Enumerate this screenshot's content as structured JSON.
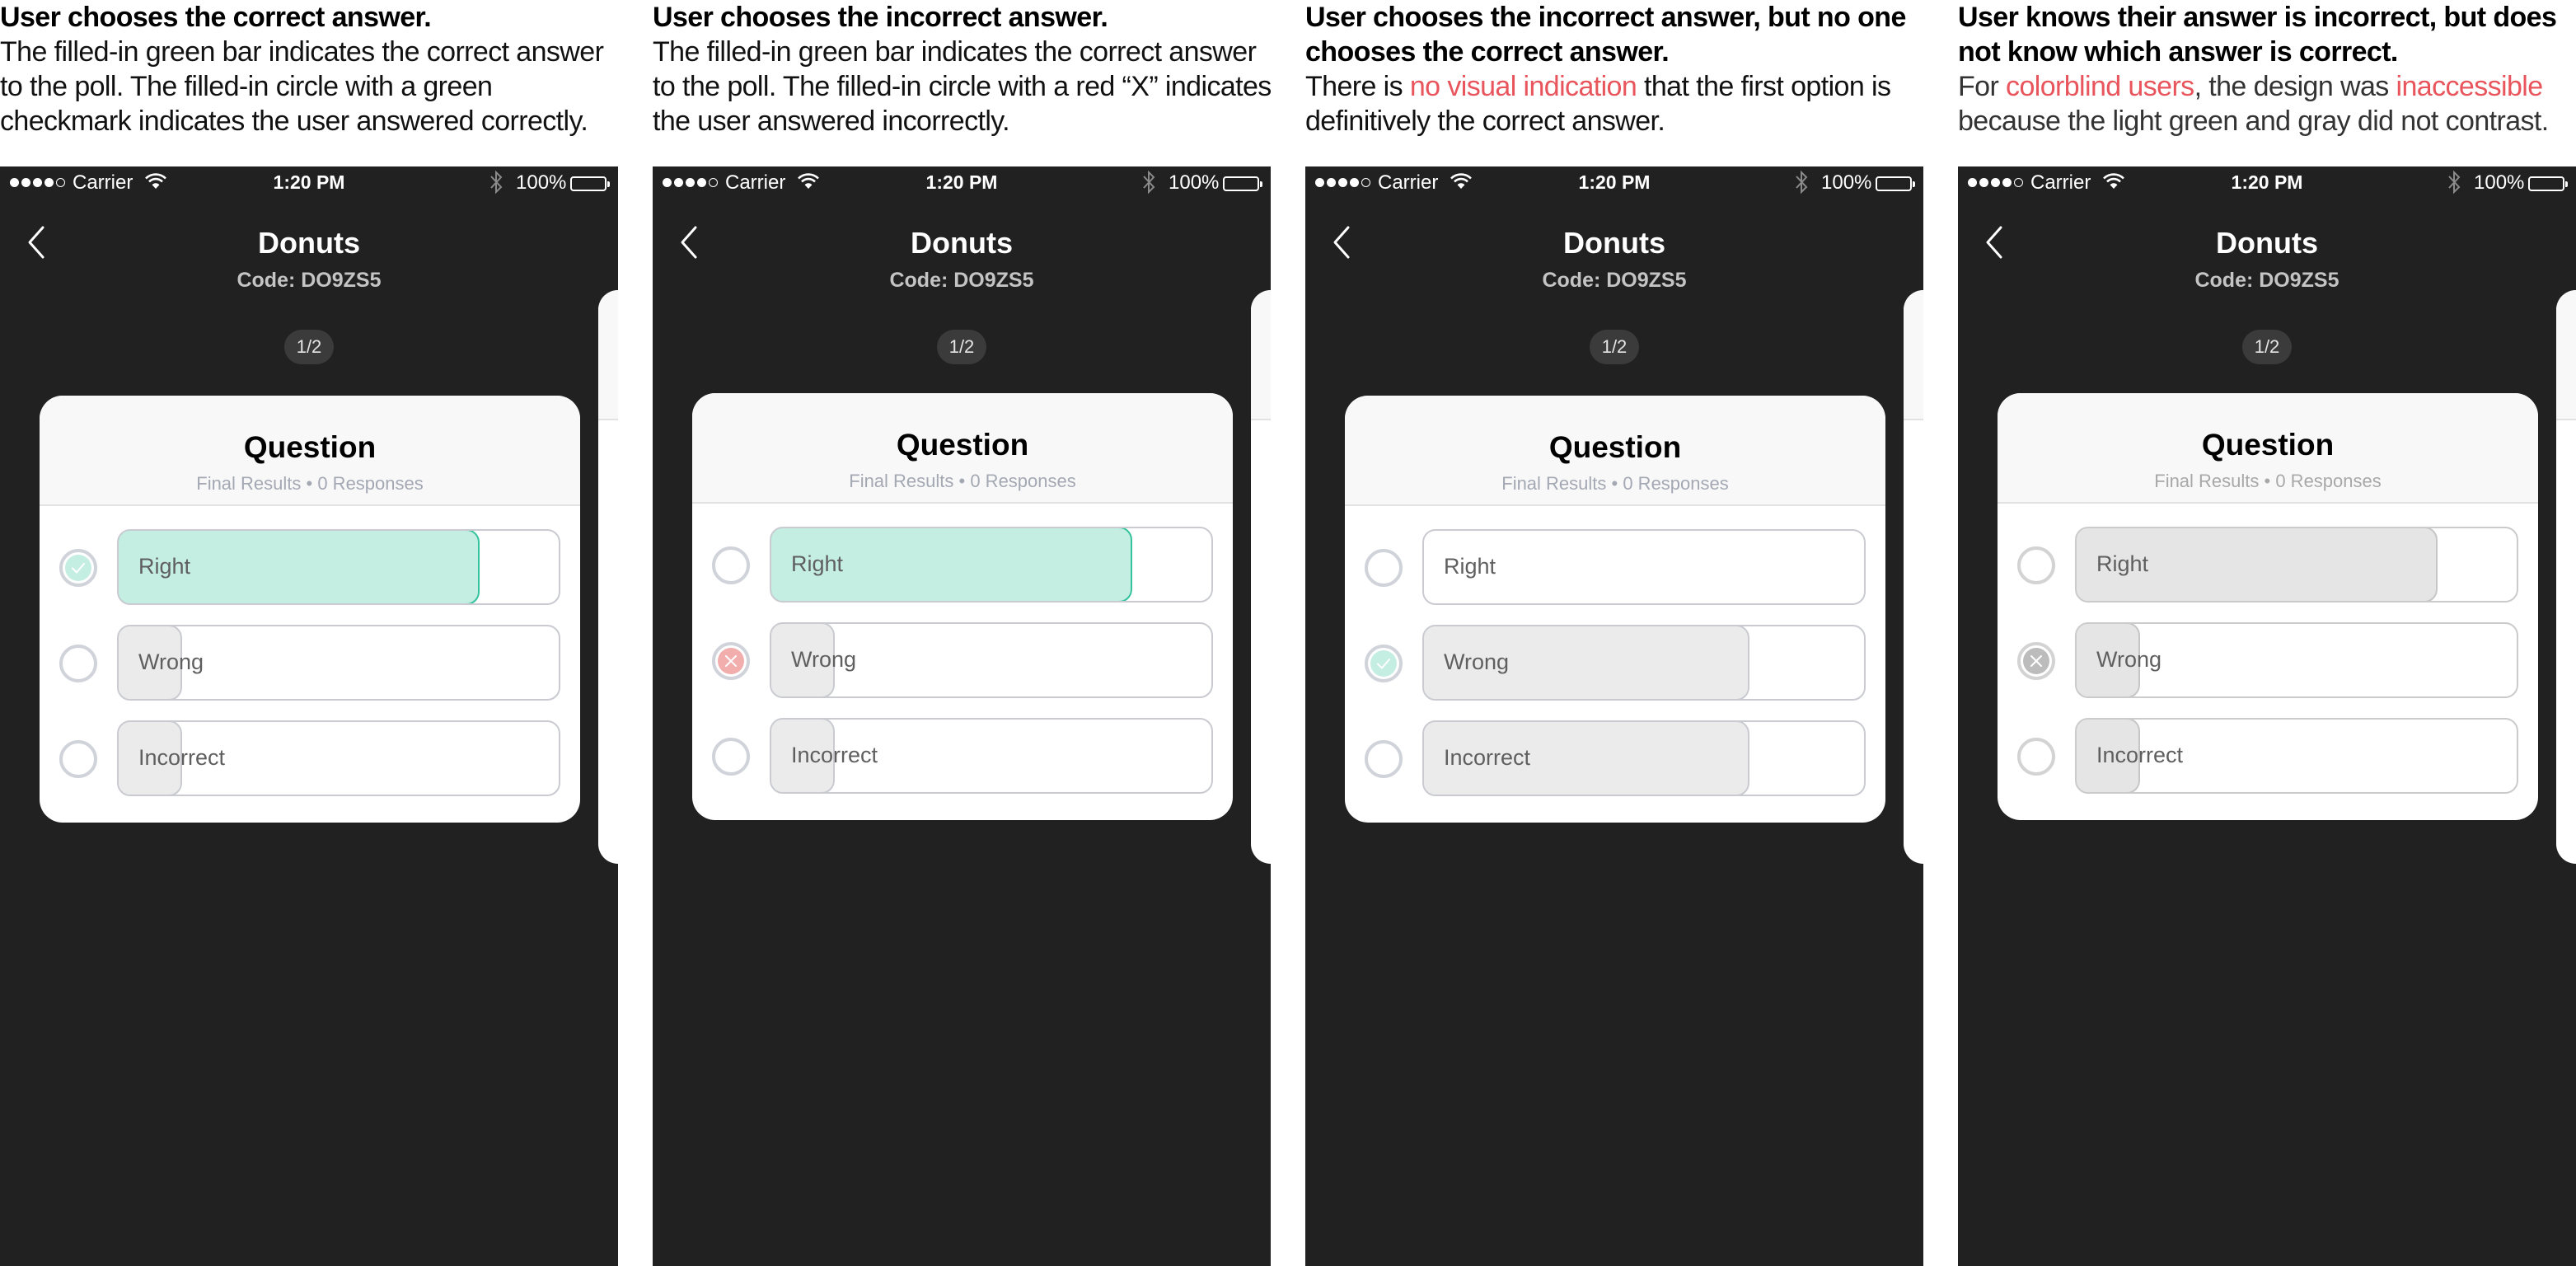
{
  "panels": [
    {
      "caption": {
        "title": "User chooses the correct answer.",
        "body": [
          {
            "text": "The filled-in green bar indicates the correct answer to the poll. The filled-in circle with a green checkmark indicates the user answered correctly.",
            "highlight": false
          }
        ]
      },
      "phone": {
        "status": {
          "carrier": "Carrier",
          "time": "1:20 PM",
          "battery": "100%"
        },
        "nav": {
          "title": "Donuts",
          "code": "Code: DO9ZS5"
        },
        "pager": "1/2",
        "card": {
          "title": "Question",
          "subtitle": "Final Results • 0 Responses",
          "options": [
            {
              "label": "Right",
              "fill": 0.81,
              "fill_style": "green",
              "selected": "check"
            },
            {
              "label": "Wrong",
              "fill": 0.14,
              "fill_style": "gray",
              "selected": "none"
            },
            {
              "label": "Incorrect",
              "fill": 0.14,
              "fill_style": "gray",
              "selected": "none"
            }
          ]
        }
      }
    },
    {
      "caption": {
        "title": "User chooses the incorrect answer.",
        "body": [
          {
            "text": "The filled-in green bar indicates the correct answer to the poll. The filled-in circle with a red “X” indicates the user answered incorrectly.",
            "highlight": false
          }
        ]
      },
      "phone": {
        "status": {
          "carrier": "Carrier",
          "time": "1:20 PM",
          "battery": "100%"
        },
        "nav": {
          "title": "Donuts",
          "code": "Code: DO9ZS5"
        },
        "pager": "1/2",
        "card": {
          "title": "Question",
          "subtitle": "Final Results • 0 Responses",
          "options": [
            {
              "label": "Right",
              "fill": 0.81,
              "fill_style": "green",
              "selected": "none"
            },
            {
              "label": "Wrong",
              "fill": 0.14,
              "fill_style": "gray",
              "selected": "x"
            },
            {
              "label": "Incorrect",
              "fill": 0.14,
              "fill_style": "gray",
              "selected": "none"
            }
          ]
        }
      }
    },
    {
      "caption": {
        "title": "User chooses the incorrect answer, but no one chooses the correct answer.",
        "body": [
          {
            "text": "There is ",
            "highlight": false
          },
          {
            "text": "no visual indication",
            "highlight": true
          },
          {
            "text": " that the first option is definitively the correct answer.",
            "highlight": false
          }
        ]
      },
      "phone": {
        "status": {
          "carrier": "Carrier",
          "time": "1:20 PM",
          "battery": "100%"
        },
        "nav": {
          "title": "Donuts",
          "code": "Code: DO9ZS5"
        },
        "pager": "1/2",
        "card": {
          "title": "Question",
          "subtitle": "Final Results • 0 Responses",
          "options": [
            {
              "label": "Right",
              "fill": 0,
              "fill_style": "gray",
              "selected": "none"
            },
            {
              "label": "Wrong",
              "fill": 0.73,
              "fill_style": "gray",
              "selected": "check"
            },
            {
              "label": "Incorrect",
              "fill": 0.73,
              "fill_style": "gray",
              "selected": "none"
            }
          ]
        }
      }
    },
    {
      "caption": {
        "title": "User knows their answer is incorrect, but does not know which answer is correct.",
        "body": [
          {
            "text": "For ",
            "highlight": false
          },
          {
            "text": "colorblind users",
            "highlight": true
          },
          {
            "text": ", the design was ",
            "highlight": false
          },
          {
            "text": "inaccessible",
            "highlight": true
          },
          {
            "text": " because the light green and gray did not contrast.",
            "highlight": false
          }
        ]
      },
      "phone": {
        "status": {
          "carrier": "Carrier",
          "time": "1:20 PM",
          "battery": "100%"
        },
        "nav": {
          "title": "Donuts",
          "code": "Code: DO9ZS5"
        },
        "pager": "1/2",
        "card": {
          "title": "Question",
          "subtitle": "Final Results • 0 Responses",
          "options": [
            {
              "label": "Right",
              "fill": 0.81,
              "fill_style": "gray4",
              "selected": "none"
            },
            {
              "label": "Wrong",
              "fill": 0.14,
              "fill_style": "gray4",
              "selected": "x"
            },
            {
              "label": "Incorrect",
              "fill": 0.14,
              "fill_style": "gray4",
              "selected": "none"
            }
          ]
        }
      }
    }
  ],
  "colors": {
    "phone_bg": "#212121",
    "correct_fill": "#c5eee3",
    "correct_border": "#35c39d",
    "wrong_mark": "#f2adad",
    "highlight_text": "#e8555c",
    "neutral_fill": "#ebebeb"
  },
  "icons": {
    "back": "chevron-left-icon",
    "wifi": "wifi-icon",
    "bluetooth": "bluetooth-icon",
    "battery": "battery-icon",
    "check": "check-circle-icon",
    "x": "x-circle-icon"
  }
}
